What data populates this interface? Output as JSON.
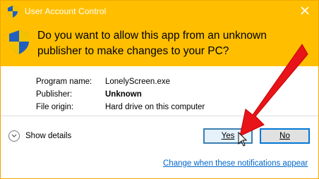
{
  "window": {
    "title": "User Account Control",
    "close_icon": "close-icon",
    "shield_icon": "uac-shield-icon"
  },
  "header": {
    "question": "Do you want to allow this app from an unknown publisher to make changes to your PC?"
  },
  "details": [
    {
      "label": "Program name:",
      "value": "LonelyScreen.exe"
    },
    {
      "label": "Publisher:",
      "value": "Unknown"
    },
    {
      "label": "File origin:",
      "value": "Hard drive on this computer"
    }
  ],
  "footer": {
    "show_details_label": "Show details",
    "yes_label": "Yes",
    "no_label": "No",
    "notification_link": "Change when these notifications appear"
  },
  "colors": {
    "title_bar": "#ffbf00",
    "arrow": "#e8141a",
    "link": "#0066cc"
  }
}
